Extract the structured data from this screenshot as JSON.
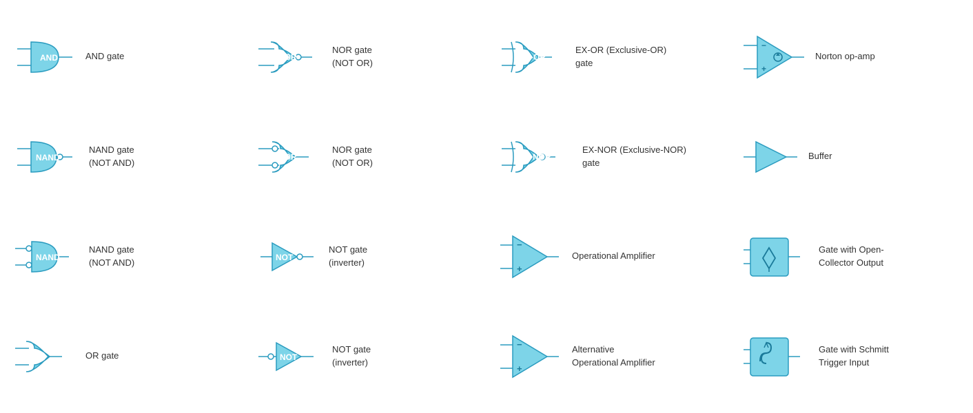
{
  "cells": [
    {
      "id": "and-gate",
      "label": "AND gate",
      "shape": "and"
    },
    {
      "id": "nor-gate-1",
      "label": "NOR gate\n(NOT OR)",
      "shape": "nor"
    },
    {
      "id": "exor-gate",
      "label": "EX-OR (Exclusive-OR)\ngate",
      "shape": "exor"
    },
    {
      "id": "norton-opamp",
      "label": "Norton op-amp",
      "shape": "norton"
    },
    {
      "id": "nand-gate-1",
      "label": "NAND gate\n(NOT AND)",
      "shape": "nand"
    },
    {
      "id": "nor-gate-2",
      "label": "NOR gate\n(NOT OR)",
      "shape": "nor2"
    },
    {
      "id": "exnor-gate",
      "label": "EX-NOR (Exclusive-NOR)\ngate",
      "shape": "exnor"
    },
    {
      "id": "buffer",
      "label": "Buffer",
      "shape": "buffer"
    },
    {
      "id": "nand-gate-2",
      "label": "NAND gate\n(NOT AND)",
      "shape": "nand2"
    },
    {
      "id": "not-gate-1",
      "label": "NOT gate\n(inverter)",
      "shape": "not"
    },
    {
      "id": "opamp",
      "label": "Operational Amplifier",
      "shape": "opamp"
    },
    {
      "id": "opencollector",
      "label": "Gate with Open-\nCollector Output",
      "shape": "opencollector"
    },
    {
      "id": "or-gate",
      "label": "OR gate",
      "shape": "or"
    },
    {
      "id": "not-gate-2",
      "label": "NOT gate\n(inverter)",
      "shape": "not2"
    },
    {
      "id": "alt-opamp",
      "label": "Alternative\nOperational Amplifier",
      "shape": "altopamp"
    },
    {
      "id": "schmitt",
      "label": "Gate with Schmitt\nTrigger Input",
      "shape": "schmitt"
    }
  ]
}
